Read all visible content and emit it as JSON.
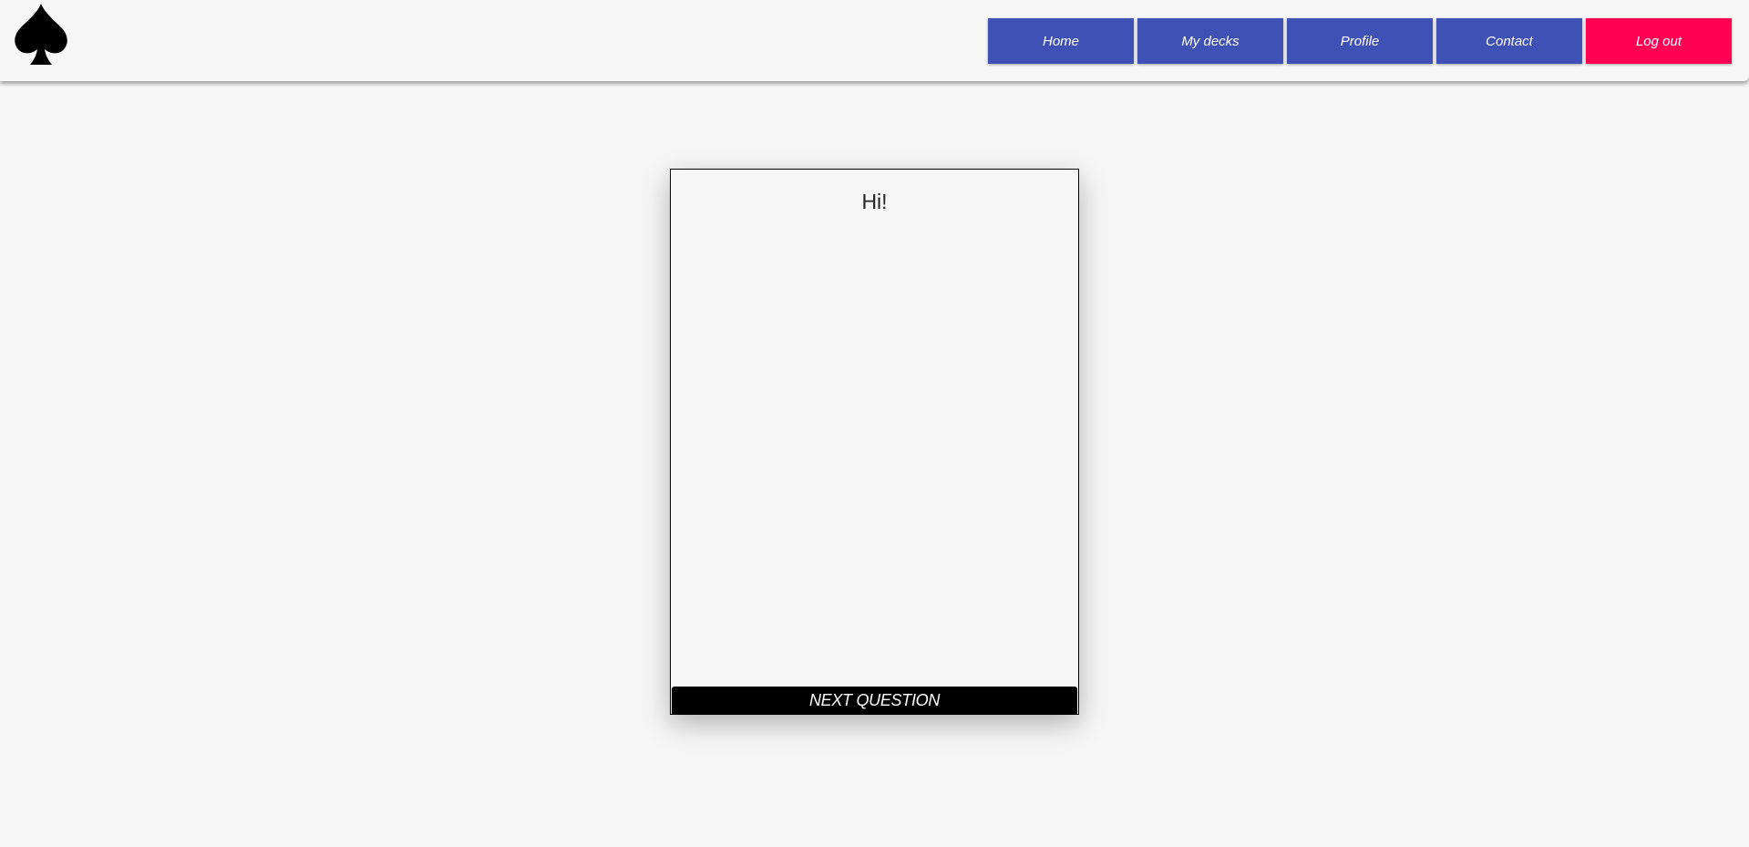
{
  "header": {
    "logo_icon": "spade-icon",
    "nav": {
      "home": "Home",
      "my_decks": "My decks",
      "profile": "Profile",
      "contact": "Contact",
      "logout": "Log out"
    },
    "colors": {
      "nav_button": "#3f51b5",
      "logout_button": "#ff0055"
    }
  },
  "card": {
    "text": "Hi!",
    "next_button": "NEXT QUESTION"
  }
}
